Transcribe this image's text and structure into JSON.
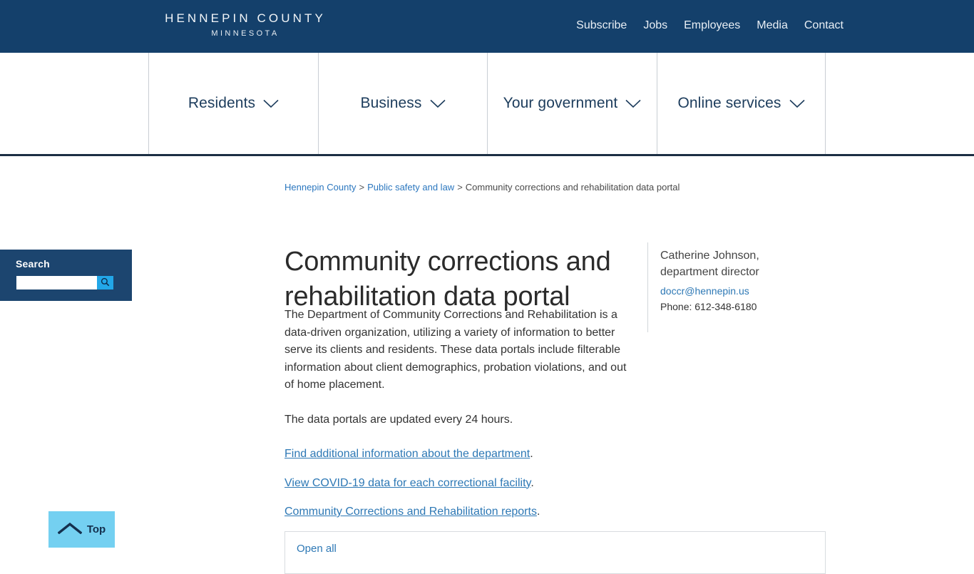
{
  "topbar": {
    "brand_main": "HENNEPIN COUNTY",
    "brand_sub": "MINNESOTA",
    "background_color": "#14406b",
    "utility_links": [
      {
        "label": "Subscribe"
      },
      {
        "label": "Jobs"
      },
      {
        "label": "Employees"
      },
      {
        "label": "Media"
      },
      {
        "label": "Contact"
      }
    ]
  },
  "mainnav": {
    "items": [
      {
        "label": "Residents",
        "icon": "chevron-down-icon"
      },
      {
        "label": "Business",
        "icon": "chevron-down-icon"
      },
      {
        "label": "Your government",
        "icon": "chevron-down-icon"
      },
      {
        "label": "Online services",
        "icon": "chevron-down-icon"
      }
    ]
  },
  "breadcrumb": {
    "items": [
      {
        "label": "Hennepin County",
        "is_link": true
      },
      {
        "label": "Public safety and law",
        "is_link": true
      },
      {
        "label": "Community corrections and rehabilitation data portal",
        "is_link": false
      }
    ],
    "separator": ">"
  },
  "page": {
    "title": "Community corrections and rehabilitation data portal",
    "paragraph_1": "The Department of Community Corrections and Rehabilitation is a data-driven organization, utilizing a variety of information to better serve its clients and residents. These data portals include filterable information about client demographics, probation violations, and out of home placement.",
    "paragraph_2": "The data portals are updated every 24 hours.",
    "links": [
      {
        "text": "Find additional information about the department",
        "trailing": "."
      },
      {
        "text": "View COVID-19 data for each correctional facility",
        "trailing": "."
      },
      {
        "text": "Community Corrections and Rehabilitation reports",
        "trailing": "."
      }
    ]
  },
  "contact": {
    "name": "Catherine Johnson, department director",
    "email": "doccr@hennepin.us",
    "phone": "Phone: 612-348-6180"
  },
  "search": {
    "label": "Search",
    "value": "",
    "placeholder": "",
    "button_icon": "search-icon",
    "panel_color": "#1c456f",
    "button_color": "#22a7e8"
  },
  "back_to_top": {
    "label": "Top",
    "icon": "chevron-up-icon",
    "color": "#74d0f1"
  },
  "accordion": {
    "open_all_label": "Open all"
  }
}
